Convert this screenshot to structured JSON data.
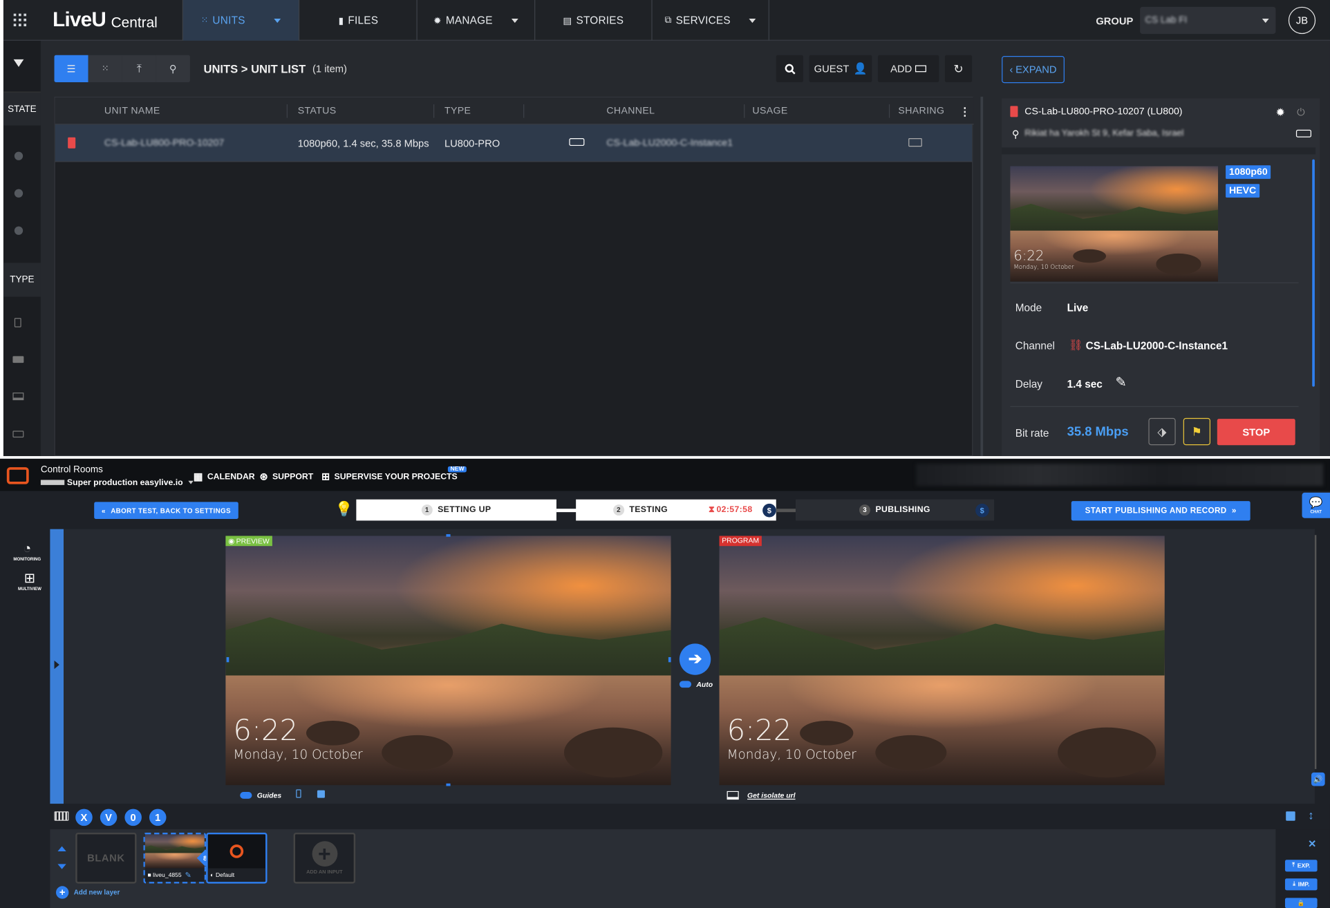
{
  "liveu": {
    "logo_main": "LiveU",
    "logo_sub": "Central",
    "nav": [
      {
        "label": "UNITS"
      },
      {
        "label": "FILES"
      },
      {
        "label": "MANAGE"
      },
      {
        "label": "STORIES"
      },
      {
        "label": "SERVICES"
      }
    ],
    "group_label": "GROUP",
    "group_value": "CS Lab FI",
    "avatar": "JB",
    "sidebar": {
      "state_label": "STATE",
      "type_label": "TYPE"
    },
    "breadcrumb": "UNITS > UNIT LIST",
    "item_count": "(1 item)",
    "guest_label": "GUEST",
    "add_label": "ADD",
    "table": {
      "headers": [
        "UNIT NAME",
        "STATUS",
        "TYPE",
        "CHANNEL",
        "USAGE",
        "SHARING"
      ],
      "row": {
        "name": "CS-Lab-LU800-PRO-10207",
        "status": "1080p60, 1.4 sec, 35.8 Mbps",
        "type": "LU800-PRO",
        "channel": "CS-Lab-LU2000-C-Instance1"
      }
    },
    "panel": {
      "expand_label": "EXPAND",
      "unit_title": "CS-Lab-LU800-PRO-10207 (LU800)",
      "location": "Rikiat ha Yarokh St 9, Kefar Saba, Israel",
      "badge_res": "1080p60",
      "badge_codec": "HEVC",
      "thumb_time": "6:22",
      "thumb_date": "Monday, 10 October",
      "mode_label": "Mode",
      "mode_value": "Live",
      "channel_label": "Channel",
      "channel_value": "CS-Lab-LU2000-C-Instance1",
      "delay_label": "Delay",
      "delay_value": "1.4 sec",
      "bitrate_label": "Bit rate",
      "bitrate_value": "35.8 Mbps",
      "stop_label": "STOP"
    }
  },
  "easylive": {
    "app_title": "Control Rooms",
    "production": "Super production easylive.io",
    "calendar": "CALENDAR",
    "support": "SUPPORT",
    "supervise": "SUPERVISE YOUR PROJECTS",
    "new_badge": "NEW",
    "abort_label": "ABORT TEST, BACK TO SETTINGS",
    "steps": [
      {
        "num": "1",
        "label": "SETTING UP"
      },
      {
        "num": "2",
        "label": "TESTING"
      },
      {
        "num": "3",
        "label": "PUBLISHING"
      }
    ],
    "timer": "02:57:58",
    "start_label": "START PUBLISHING AND RECORD",
    "chat_label": "CHAT",
    "monitoring_label": "MONITORING",
    "multiview_label": "MULTIVIEW",
    "preview_label": "PREVIEW",
    "program_label": "PROGRAM",
    "screen_time": "6:22",
    "screen_date": "Monday, 10 October",
    "auto_label": "Auto",
    "guides_label": "Guides",
    "isolate_label": "Get isolate url",
    "layer_buttons": [
      "X",
      "V",
      "0",
      "1"
    ],
    "blank_label": "BLANK",
    "input1_name": "liveu_4855",
    "input1_badge": "8",
    "input2_name": "Default",
    "add_input_label": "ADD AN INPUT",
    "add_layer_label": "Add new layer",
    "exp_label": "EXP.",
    "imp_label": "IMP."
  }
}
